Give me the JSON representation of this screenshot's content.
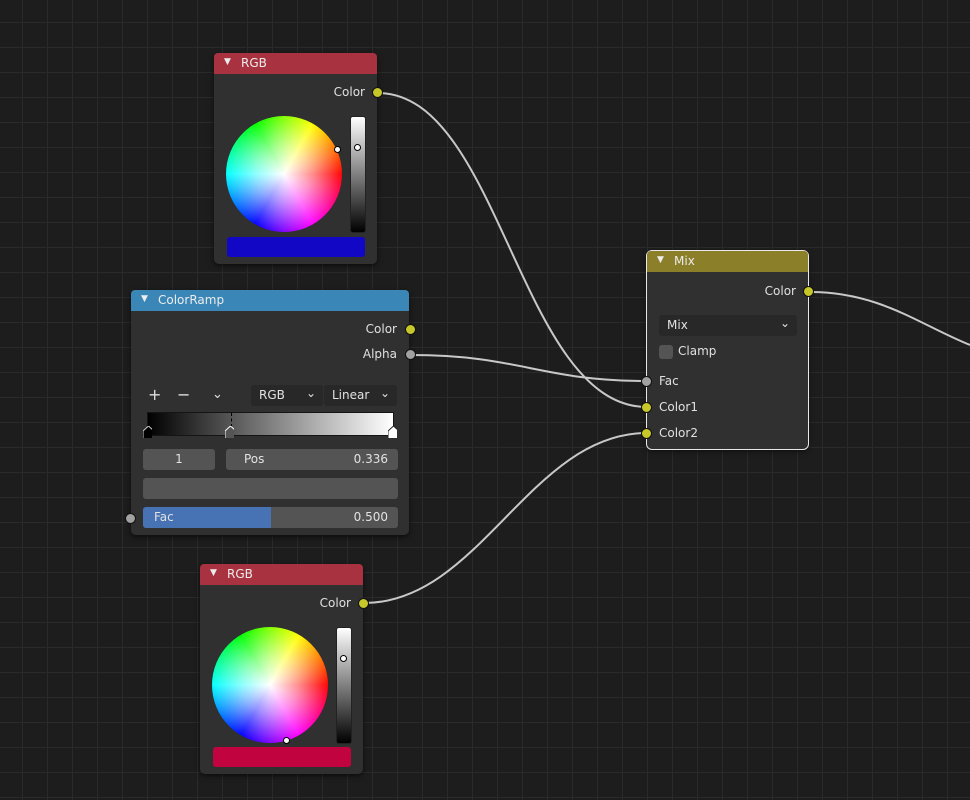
{
  "rgb_top": {
    "title": "RGB",
    "output_label": "Color",
    "swatch_color": "#1207c4",
    "value_level": 0.75
  },
  "colorramp": {
    "title": "ColorRamp",
    "outputs": [
      "Color",
      "Alpha"
    ],
    "color_mode": "RGB",
    "interpolation": "Linear",
    "stop_index": "1",
    "pos_label": "Pos",
    "pos_value": "0.336",
    "fac_label": "Fac",
    "fac_value": "0.500",
    "fac_fraction": 0.5
  },
  "mix": {
    "title": "Mix",
    "output_label": "Color",
    "blend_mode": "Mix",
    "clamp_label": "Clamp",
    "clamp_checked": false,
    "inputs": [
      "Fac",
      "Color1",
      "Color2"
    ]
  },
  "rgb_bottom": {
    "title": "RGB",
    "output_label": "Color",
    "swatch_color": "#c1043f",
    "value_level": 0.75
  },
  "colors": {
    "rgb_header": "#a8323f",
    "colorramp_header": "#3a86b6",
    "mix_header": "#8c7f2a",
    "color_socket": "#c7c729",
    "float_socket": "#a1a1a1",
    "fac_fill": "#4772b3"
  }
}
